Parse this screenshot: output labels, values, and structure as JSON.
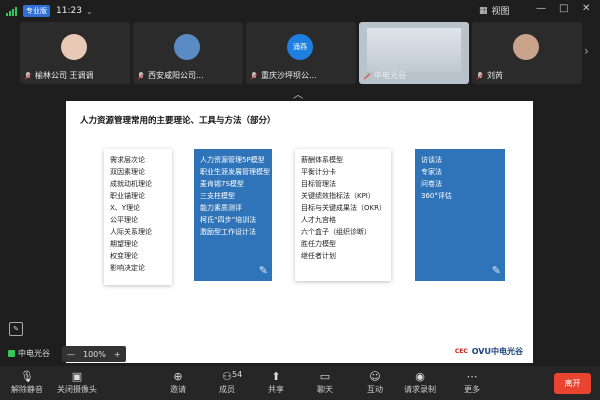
{
  "topbar": {
    "badge": "专业版",
    "time": "11:23",
    "view_label": "视图",
    "controls": [
      "—",
      "□",
      "✕"
    ]
  },
  "participants": [
    {
      "name": "榆林公司 王调调",
      "avatar_color": "#e8c9b5"
    },
    {
      "name": "西安咸阳公司...",
      "avatar_color": "#5b8bc4"
    },
    {
      "name": "重庆沙坪坝公...",
      "avatar_label": "涌燕",
      "avatar_color": "#1f7fe0"
    },
    {
      "name": "中电光谷",
      "avatar_color": "#d8dfe6"
    },
    {
      "name": "刘芮",
      "avatar_color": "#c9a38c"
    }
  ],
  "slide": {
    "title": "人力资源管理常用的主要理论、工具与方法（部分）",
    "columns": [
      {
        "style": "white",
        "items": [
          "需求层次论",
          "双因素理论",
          "成就动机理论",
          "职业锚理论",
          "X、Y理论",
          "公平理论",
          "人际关系理论",
          "期望理论",
          "权变理论",
          "影响决定论"
        ]
      },
      {
        "style": "blue",
        "items": [
          "人力资源管理5P模型",
          "职业生涯发展管理模型",
          "麦肯锡7S模型",
          "三支柱模型",
          "能力素质测评",
          "柯氏“四步”培训法",
          "激励型工作设计法"
        ]
      },
      {
        "style": "white",
        "items": [
          "薪酬体系模型",
          "平衡计分卡",
          "目标管理法",
          "关键绩效指标法（KPI）",
          "目标与关键成果法（OKR）",
          "人才九宫格",
          "六个盒子（组织诊断）",
          "胜任力模型",
          "继任者计划"
        ]
      },
      {
        "style": "blue",
        "items": [
          "访谈法",
          "专家法",
          "问卷法",
          "360°评估"
        ]
      }
    ],
    "logo_mark": "CEC",
    "logo_text": "OVU中电光谷"
  },
  "share": {
    "label": "中电光谷",
    "zoom_minus": "—",
    "zoom_value": "100%",
    "zoom_plus": "+"
  },
  "toolbar": {
    "mute": "解除静音",
    "camera": "关闭摄像头",
    "invite": "邀请",
    "members": "成员",
    "member_count": "54",
    "share": "共享",
    "chat": "聊天",
    "interact": "互动",
    "record": "请求录制",
    "more": "更多",
    "leave": "离开"
  }
}
